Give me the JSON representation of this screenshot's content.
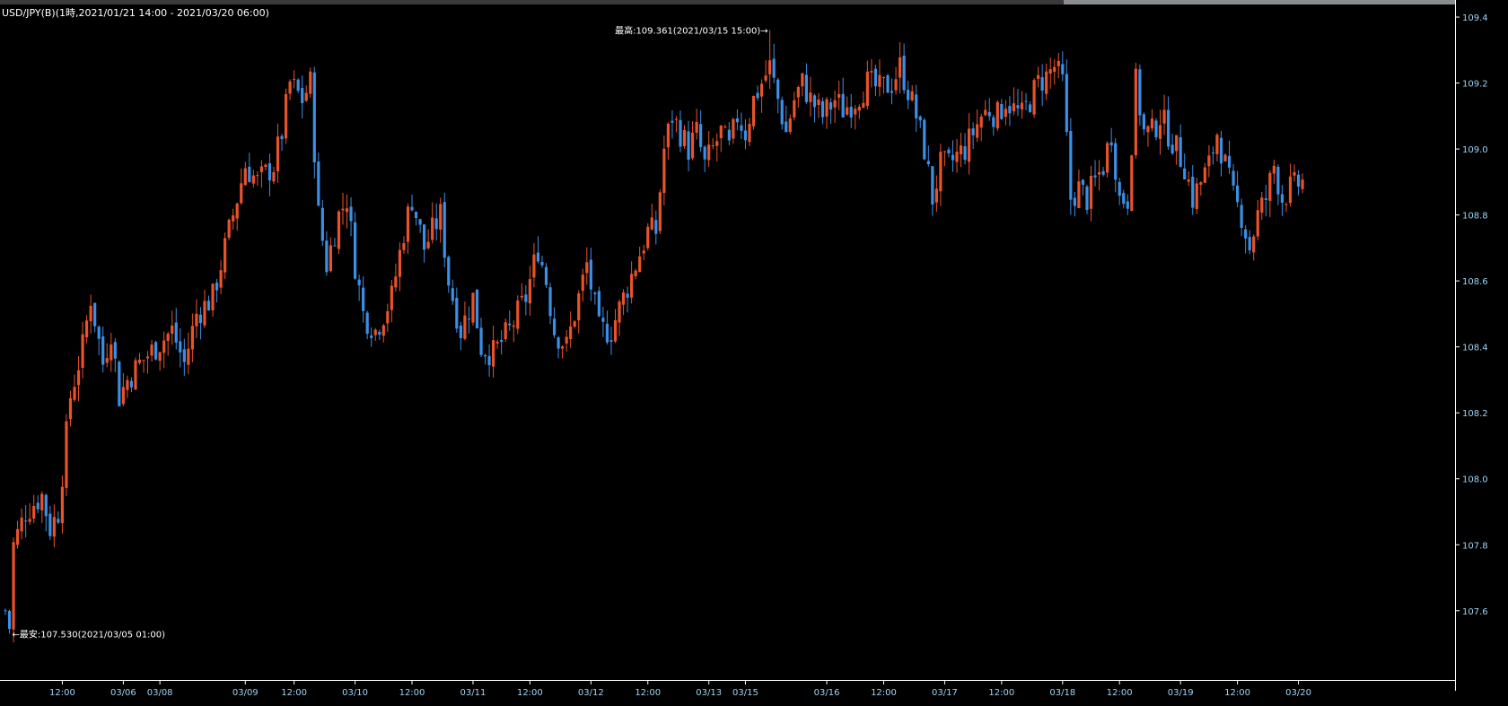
{
  "window": {
    "title": "USD/JPY(B)(1時,2021/01/21 14:00 - 2021/03/20 06:00)"
  },
  "colors": {
    "background": "#000000",
    "up": "#e8532a",
    "down": "#3b8fe6",
    "axis": "#ffffff",
    "tick_label": "#9fd3f5",
    "day_label": "#9fd3f5",
    "scrollbar_thumb": "#8a8d92"
  },
  "chart_data": {
    "type": "candlestick",
    "title": "USD/JPY(B)(1時,2021/01/21 14:00 - 2021/03/20 06:00)",
    "ylim": [
      107.39,
      109.43
    ],
    "y_ticks": [
      {
        "value": 109.4,
        "label": "109.4"
      },
      {
        "value": 109.2,
        "label": "109.2"
      },
      {
        "value": 109.0,
        "label": "109.0"
      },
      {
        "value": 108.8,
        "label": "108.8"
      },
      {
        "value": 108.6,
        "label": "108.6"
      },
      {
        "value": 108.4,
        "label": "108.4"
      },
      {
        "value": 108.2,
        "label": "108.2"
      },
      {
        "value": 108.0,
        "label": "108.0"
      },
      {
        "value": 107.8,
        "label": "107.8"
      },
      {
        "value": 107.6,
        "label": "107.6"
      }
    ],
    "x_ticks": [
      {
        "index": 14,
        "label": "12:00"
      },
      {
        "index": 29,
        "label": "03/06"
      },
      {
        "index": 38,
        "label": "03/08"
      },
      {
        "index": 59,
        "label": "03/09"
      },
      {
        "index": 71,
        "label": "12:00"
      },
      {
        "index": 86,
        "label": "03/10"
      },
      {
        "index": 100,
        "label": "12:00"
      },
      {
        "index": 115,
        "label": "03/11"
      },
      {
        "index": 129,
        "label": "12:00"
      },
      {
        "index": 144,
        "label": "03/12"
      },
      {
        "index": 158,
        "label": "12:00"
      },
      {
        "index": 173,
        "label": "03/13"
      },
      {
        "index": 182,
        "label": "03/15"
      },
      {
        "index": 202,
        "label": "03/16"
      },
      {
        "index": 216,
        "label": "12:00"
      },
      {
        "index": 231,
        "label": "03/17"
      },
      {
        "index": 245,
        "label": "12:00"
      },
      {
        "index": 260,
        "label": "03/18"
      },
      {
        "index": 274,
        "label": "12:00"
      },
      {
        "index": 289,
        "label": "03/19"
      },
      {
        "index": 303,
        "label": "12:00"
      },
      {
        "index": 318,
        "label": "03/20"
      }
    ],
    "annotations": {
      "high": {
        "index": 188,
        "value": 109.361,
        "label": "最高:109.361(2021/03/15 15:00)→"
      },
      "low": {
        "index": 1,
        "value": 107.53,
        "label": "←最安:107.530(2021/03/05 01:00)"
      }
    },
    "close_path": [
      [
        0,
        107.6
      ],
      [
        1,
        107.55
      ],
      [
        2,
        107.8
      ],
      [
        5,
        107.9
      ],
      [
        9,
        107.95
      ],
      [
        11,
        107.85
      ],
      [
        13,
        107.9
      ],
      [
        16,
        108.25
      ],
      [
        19,
        108.4
      ],
      [
        21,
        108.55
      ],
      [
        24,
        108.35
      ],
      [
        26,
        108.45
      ],
      [
        28,
        108.25
      ],
      [
        30,
        108.3
      ],
      [
        33,
        108.35
      ],
      [
        37,
        108.4
      ],
      [
        41,
        108.45
      ],
      [
        44,
        108.35
      ],
      [
        47,
        108.5
      ],
      [
        51,
        108.55
      ],
      [
        54,
        108.7
      ],
      [
        57,
        108.85
      ],
      [
        59,
        108.95
      ],
      [
        62,
        108.9
      ],
      [
        66,
        108.95
      ],
      [
        68,
        109.05
      ],
      [
        70,
        109.2
      ],
      [
        73,
        109.15
      ],
      [
        75,
        109.2
      ],
      [
        77,
        108.8
      ],
      [
        79,
        108.65
      ],
      [
        82,
        108.8
      ],
      [
        84,
        108.85
      ],
      [
        86,
        108.65
      ],
      [
        88,
        108.5
      ],
      [
        91,
        108.45
      ],
      [
        95,
        108.55
      ],
      [
        98,
        108.75
      ],
      [
        100,
        108.85
      ],
      [
        103,
        108.7
      ],
      [
        107,
        108.8
      ],
      [
        109,
        108.6
      ],
      [
        112,
        108.45
      ],
      [
        115,
        108.55
      ],
      [
        117,
        108.4
      ],
      [
        120,
        108.38
      ],
      [
        124,
        108.45
      ],
      [
        128,
        108.55
      ],
      [
        131,
        108.7
      ],
      [
        133,
        108.6
      ],
      [
        135,
        108.45
      ],
      [
        138,
        108.4
      ],
      [
        141,
        108.55
      ],
      [
        143,
        108.65
      ],
      [
        146,
        108.45
      ],
      [
        149,
        108.45
      ],
      [
        152,
        108.55
      ],
      [
        155,
        108.65
      ],
      [
        158,
        108.75
      ],
      [
        160,
        108.75
      ],
      [
        162,
        109.0
      ],
      [
        164,
        109.1
      ],
      [
        166,
        109.05
      ],
      [
        168,
        109.0
      ],
      [
        170,
        109.05
      ],
      [
        172,
        108.95
      ],
      [
        174,
        109.0
      ],
      [
        176,
        109.05
      ],
      [
        178,
        109.0
      ],
      [
        180,
        109.1
      ],
      [
        182,
        109.05
      ],
      [
        184,
        109.15
      ],
      [
        186,
        109.2
      ],
      [
        188,
        109.25
      ],
      [
        190,
        109.15
      ],
      [
        192,
        109.05
      ],
      [
        194,
        109.15
      ],
      [
        196,
        109.2
      ],
      [
        198,
        109.15
      ],
      [
        201,
        109.1
      ],
      [
        204,
        109.15
      ],
      [
        206,
        109.12
      ],
      [
        209,
        109.15
      ],
      [
        212,
        109.2
      ],
      [
        215,
        109.18
      ],
      [
        218,
        109.2
      ],
      [
        220,
        109.25
      ],
      [
        222,
        109.18
      ],
      [
        224,
        109.1
      ],
      [
        226,
        109.0
      ],
      [
        228,
        108.85
      ],
      [
        230,
        108.95
      ],
      [
        232,
        108.95
      ],
      [
        234,
        108.98
      ],
      [
        236,
        109.0
      ],
      [
        238,
        109.05
      ],
      [
        240,
        109.1
      ],
      [
        242,
        109.12
      ],
      [
        244,
        109.1
      ],
      [
        246,
        109.15
      ],
      [
        248,
        109.12
      ],
      [
        250,
        109.1
      ],
      [
        252,
        109.15
      ],
      [
        254,
        109.2
      ],
      [
        256,
        109.22
      ],
      [
        258,
        109.25
      ],
      [
        260,
        109.2
      ],
      [
        262,
        108.85
      ],
      [
        264,
        108.88
      ],
      [
        266,
        108.85
      ],
      [
        268,
        108.9
      ],
      [
        270,
        108.95
      ],
      [
        272,
        109.05
      ],
      [
        274,
        108.85
      ],
      [
        276,
        108.85
      ],
      [
        278,
        109.2
      ],
      [
        280,
        109.05
      ],
      [
        282,
        109.05
      ],
      [
        284,
        109.1
      ],
      [
        286,
        109.05
      ],
      [
        288,
        109.0
      ],
      [
        290,
        108.95
      ],
      [
        292,
        108.85
      ],
      [
        294,
        108.9
      ],
      [
        296,
        108.95
      ],
      [
        298,
        109.05
      ],
      [
        300,
        108.95
      ],
      [
        302,
        108.85
      ],
      [
        304,
        108.8
      ],
      [
        306,
        108.7
      ],
      [
        308,
        108.8
      ],
      [
        310,
        108.85
      ],
      [
        312,
        108.95
      ],
      [
        314,
        108.85
      ],
      [
        316,
        108.88
      ],
      [
        319,
        108.9
      ]
    ],
    "close_path_note": "approximate close values per hourly bar index, interpolated between points"
  }
}
